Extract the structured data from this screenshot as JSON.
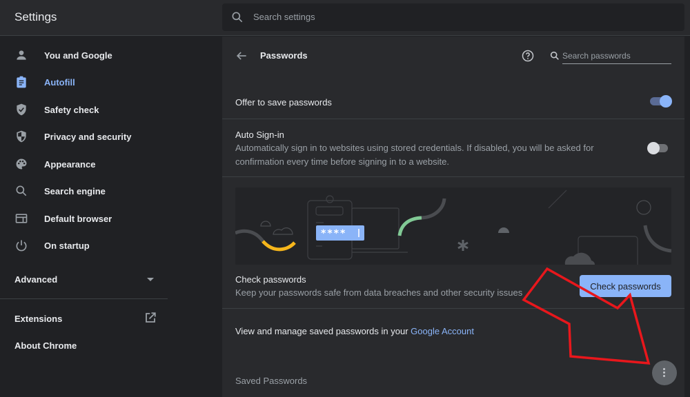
{
  "header": {
    "app_title": "Settings",
    "search_placeholder": "Search settings"
  },
  "sidebar": {
    "items": [
      {
        "label": "You and Google",
        "icon": "person-icon",
        "active": false
      },
      {
        "label": "Autofill",
        "icon": "clipboard-icon",
        "active": true
      },
      {
        "label": "Safety check",
        "icon": "shield-check-icon",
        "active": false
      },
      {
        "label": "Privacy and security",
        "icon": "shield-half-icon",
        "active": false
      },
      {
        "label": "Appearance",
        "icon": "palette-icon",
        "active": false
      },
      {
        "label": "Search engine",
        "icon": "search-icon",
        "active": false
      },
      {
        "label": "Default browser",
        "icon": "browser-window-icon",
        "active": false
      },
      {
        "label": "On startup",
        "icon": "power-icon",
        "active": false
      }
    ],
    "advanced_label": "Advanced",
    "extensions_label": "Extensions",
    "about_label": "About Chrome"
  },
  "passwords": {
    "title": "Passwords",
    "search_placeholder": "Search passwords",
    "offer_to_save": {
      "label": "Offer to save passwords",
      "enabled": true
    },
    "auto_signin": {
      "label": "Auto Sign-in",
      "description": "Automatically sign in to websites using stored credentials. If disabled, you will be asked for confirmation every time before signing in to a website.",
      "enabled": false
    },
    "illustration_masked_text": "****",
    "check": {
      "label": "Check passwords",
      "description": "Keep your passwords safe from data breaches and other security issues",
      "button_label": "Check passwords"
    },
    "manage": {
      "text": "View and manage saved passwords in your ",
      "link_text": "Google Account"
    },
    "saved_title": "Saved Passwords"
  },
  "colors": {
    "accent": "#8ab4f8",
    "background": "#202124",
    "card": "#292a2d",
    "annotation_arrow": "#e8171c"
  }
}
